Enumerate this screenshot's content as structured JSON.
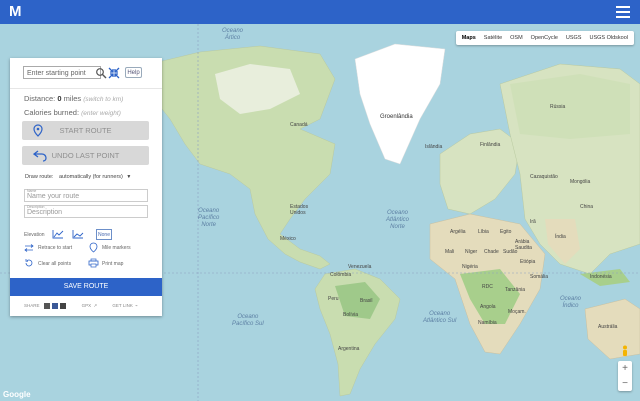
{
  "app": {
    "logo_letter": "M",
    "accent": "#2d63c8"
  },
  "map_types": [
    "Maps",
    "Satélite",
    "OSM",
    "OpenCycle",
    "USGS",
    "USGS Oldskool"
  ],
  "map_labels": {
    "arctic": "Oceano\nÁrtico",
    "greenland": "Groenlândia",
    "n_pacific": "Oceano\nPacífico\nNorte",
    "n_atlantic": "Oceano\nAtlântico\nNorte",
    "s_pacific": "Oceano\nPacífico Sul",
    "s_atlantic": "Oceano\nAtlântico Sul",
    "indian": "Oceano\nÍndico",
    "eua": "Estados\nUnidos",
    "canada": "Canadá",
    "mexico": "México",
    "brasil": "Brasil",
    "russia": "Rússia",
    "china": "China",
    "india": "Índia",
    "australia": "Austrália",
    "libia": "Líbia",
    "egito": "Egito",
    "argelia": "Argélia",
    "mali": "Mali",
    "niger": "Níger",
    "chad": "Chade",
    "sudao": "Sudão",
    "congo": "RDC",
    "angola": "Angola",
    "sa": "Arábia\nSaudita",
    "iran": "Irã",
    "kaz": "Cazaquistão",
    "mongolia": "Mongólia",
    "indonesia": "Indonésia",
    "peru": "Peru",
    "bolivia": "Bolívia",
    "argentina": "Argentina",
    "colombia": "Colômbia",
    "venezuela": "Venezuela",
    "islandia": "Islândia",
    "finland": "Finlândia",
    "somalia": "Somália",
    "namibia": "Namíbia",
    "ethiopia": "Etiópia",
    "nigeria": "Nigéria",
    "tanzania": "Tanzânia",
    "mozambique": "Moçam."
  },
  "panel": {
    "start_placeholder": "Enter starting point",
    "help_label": "Help",
    "distance_label": "Distance:",
    "distance_value": "0",
    "distance_unit": "miles",
    "distance_switch": "(switch to km)",
    "calories_label": "Calories burned:",
    "calories_hint": "(enter weight)",
    "start_route_label": "START ROUTE",
    "undo_label": "UNDO LAST POINT",
    "draw_route_label": "Draw route:",
    "draw_route_value": "automatically (for runners)",
    "name_small": "Name",
    "name_value": "Name your route",
    "desc_small": "Description",
    "desc_value": "Description",
    "elevation_label": "Elevation",
    "none_label": "None",
    "retrace_label": "Retrace to start",
    "mile_markers_label": "Mile markers",
    "clear_label": "Clear all points",
    "print_label": "Print map",
    "save_label": "SAVE ROUTE",
    "share_label": "SHARE",
    "gpx_label": "GPX",
    "getlink_label": "GET LINK"
  },
  "google_label": "Google"
}
